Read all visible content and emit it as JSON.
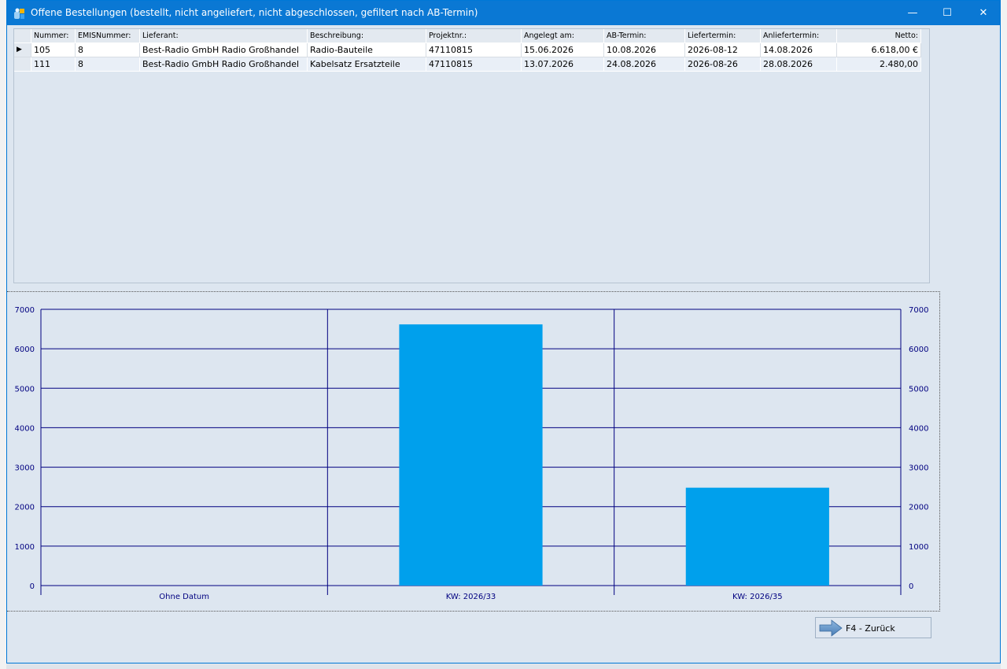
{
  "window": {
    "title": "Offene Bestellungen (bestellt, nicht angeliefert, nicht abgeschlossen, gefiltert nach AB-Termin)",
    "minimize_glyph": "—",
    "maximize_glyph": "☐",
    "close_glyph": "✕"
  },
  "table": {
    "columns": [
      "Nummer:",
      "EMISNummer:",
      "Lieferant:",
      "Beschreibung:",
      "Projektnr.:",
      "Angelegt am:",
      "AB-Termin:",
      "Liefertermin:",
      "Anliefertermin:",
      "Netto:"
    ],
    "rows": [
      [
        "105",
        "8",
        "Best-Radio GmbH Radio Großhandel",
        "Radio-Bauteile",
        "47110815",
        "15.06.2026",
        "10.08.2026",
        "2026-08-12",
        "14.08.2026",
        "6.618,00 €"
      ],
      [
        "111",
        "8",
        "Best-Radio GmbH Radio Großhandel",
        "Kabelsatz Ersatzteile",
        "47110815",
        "13.07.2026",
        "24.08.2026",
        "2026-08-26",
        "28.08.2026",
        "2.480,00"
      ]
    ],
    "current_row_indicator": "▶"
  },
  "chart_data": {
    "type": "bar",
    "categories": [
      "Ohne Datum",
      "KW: 2026/33",
      "KW: 2026/35"
    ],
    "values": [
      0,
      6618,
      2480
    ],
    "ylim": [
      0,
      7000
    ],
    "yticks": [
      0,
      1000,
      2000,
      3000,
      4000,
      5000,
      6000,
      7000
    ],
    "grid": true,
    "bar_color": "#00a0ec",
    "grid_color": "#000080",
    "title": "",
    "xlabel": "",
    "ylabel": ""
  },
  "buttons": {
    "back_label": "F4 - Zurück"
  },
  "icons": {
    "app": "app-icon",
    "back": "arrow-right-icon"
  }
}
